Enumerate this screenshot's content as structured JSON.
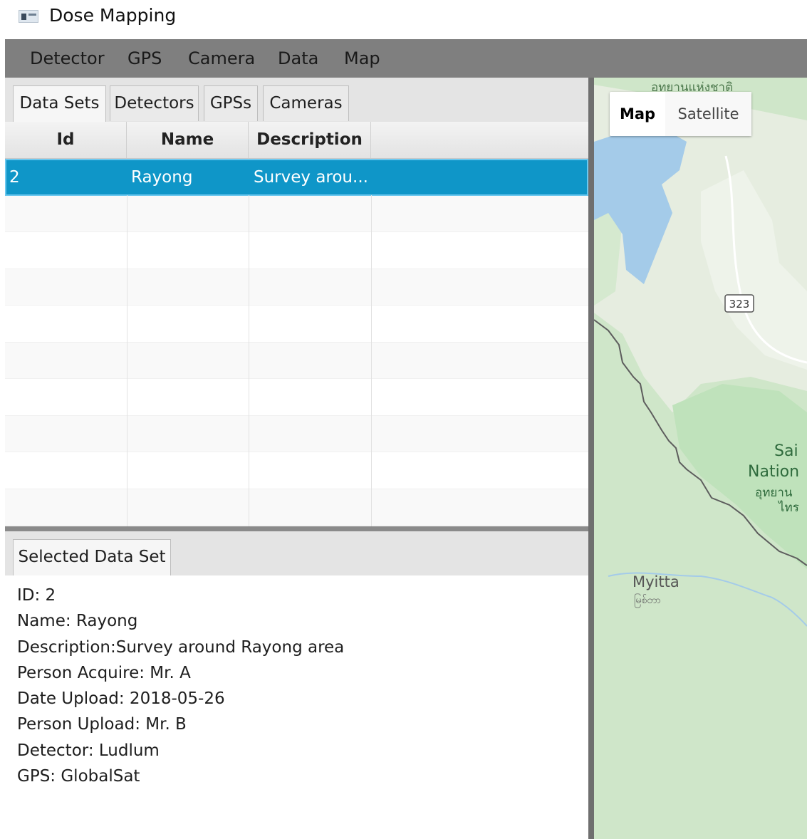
{
  "window": {
    "title": "Dose Mapping"
  },
  "menu": [
    "Detector",
    "GPS",
    "Camera",
    "Data",
    "Map"
  ],
  "tabs": [
    "Data Sets",
    "Detectors",
    "GPSs",
    "Cameras"
  ],
  "table": {
    "columns": [
      "Id",
      "Name",
      "Description"
    ],
    "rows": [
      {
        "id": "2",
        "name": "Rayong",
        "description": "Survey arou..."
      }
    ]
  },
  "selected_panel": {
    "tab": "Selected Data Set",
    "lines": [
      "ID: 2",
      "Name: Rayong",
      "Description:Survey around Rayong area",
      "Person Acquire: Mr. A",
      "Date Upload: 2018-05-26",
      "Person Upload: Mr. B",
      "Detector: Ludlum",
      "GPS: GlobalSat"
    ]
  },
  "map": {
    "type_buttons": {
      "map": "Map",
      "satellite": "Satellite"
    },
    "labels": {
      "park_top_thai": "อุทยานแห่งชาติ",
      "road_shield": "323",
      "sai_1": "Sai",
      "sai_2": "Nation",
      "sai_thai_1": "อุทยาน",
      "sai_thai_2": "ไทร",
      "town": "Myitta",
      "town_burmese": "မြစ်တာ"
    },
    "colors": {
      "water": "#a4cbe9",
      "park": "#c2e5c0",
      "land": "#e6ede0",
      "border": "#5d5d5d"
    }
  }
}
